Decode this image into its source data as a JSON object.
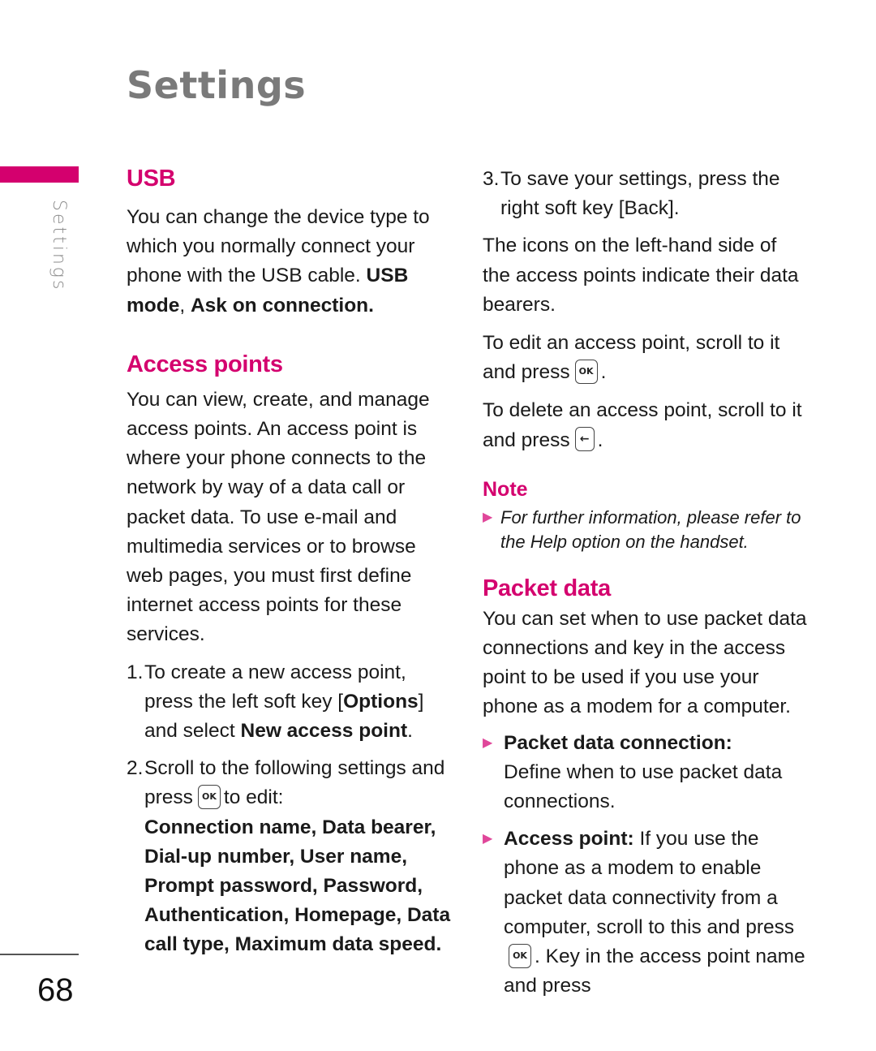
{
  "page": {
    "title": "Settings",
    "side_label": "Settings",
    "number": "68",
    "accent_color": "#d4006e"
  },
  "usb": {
    "heading": "USB",
    "body_1": "You can change the device type to which you normally connect your phone with the USB cable. ",
    "body_bold": "USB mode",
    "body_2": ", ",
    "body_bold_2": "Ask on connection."
  },
  "access_points": {
    "heading": "Access points",
    "intro": "You can view, create, and manage access points. An access point is where your phone connects to the network by way of a data call or packet data. To use e-mail and multimedia services or to browse web pages, you must first define internet access points for these services.",
    "steps": [
      {
        "num": "1.",
        "text_1": "To create a new access point, press the left soft key [",
        "bold_1": "Options",
        "text_2": "] and select ",
        "bold_2": "New access point",
        "text_3": "."
      },
      {
        "num": "2.",
        "text_1": "Scroll to the following settings and press",
        "key": "OK",
        "text_2": "to edit:",
        "bold": "Connection name, Data bearer, Dial-up number, User name, Prompt password, Password, Authentication, Homepage, Data call type, Maximum data speed."
      },
      {
        "num": "3.",
        "text": "To save your settings, press the right soft key [Back]."
      }
    ],
    "icons_para": "The icons on the left-hand side of the access points indicate their data bearers.",
    "edit_para": "To edit an access point, scroll to it and press",
    "edit_key": "OK",
    "delete_para": "To delete an access point, scroll to it and press",
    "delete_key": "←"
  },
  "note": {
    "title": "Note",
    "text": "For further information, please refer to the Help option on the handset."
  },
  "packet_data": {
    "heading": "Packet data",
    "intro": "You can set when to use packet data connections and key in the access point to be used if you use your phone as a modem for a computer.",
    "bullets": [
      {
        "label": "Packet data connection:",
        "text": "Define when to use packet data connections."
      },
      {
        "label": "Access point:",
        "text_1": " If you use the phone as a modem to enable packet data connectivity from a computer, scroll to this and press",
        "key": "OK",
        "text_2": ". Key in the access point name and press"
      }
    ]
  }
}
